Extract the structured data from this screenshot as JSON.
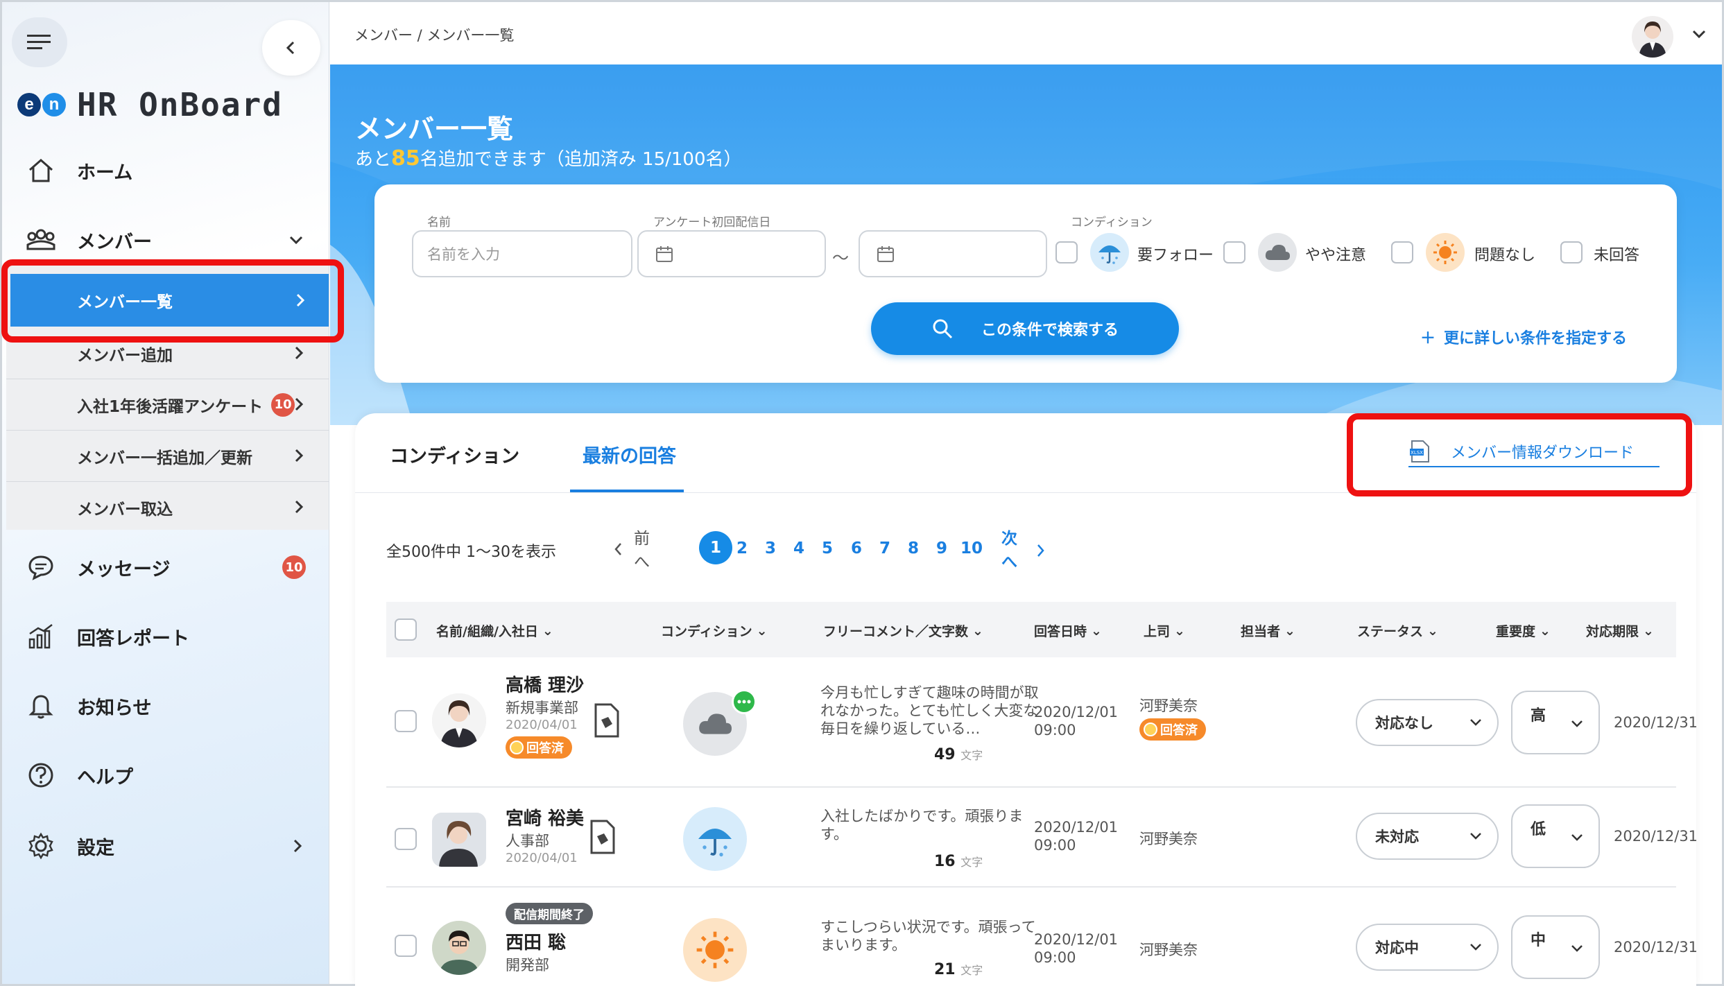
{
  "app": {
    "logo_text": "HR OnBoard",
    "logo_mark": [
      "e",
      "n"
    ]
  },
  "sidebar": {
    "home": "ホーム",
    "members": "メンバー",
    "sub": {
      "active": "メンバー一覧",
      "items": [
        "メンバー追加",
        "入社1年後活躍アンケート",
        "メンバー一括追加／更新",
        "メンバー取込"
      ],
      "survey_badge": "10"
    },
    "messages": "メッセージ",
    "messages_badge": "10",
    "report": "回答レポート",
    "notices": "お知らせ",
    "help": "ヘルプ",
    "settings": "設定"
  },
  "header": {
    "breadcrumb": "メンバー / メンバー一覧"
  },
  "page": {
    "title": "メンバー一覧",
    "sub_prefix": "あと",
    "sub_num": "85",
    "sub_suffix": "名追加できます（追加済み 15/100名）"
  },
  "search": {
    "name_label": "名前",
    "name_placeholder": "名前を入力",
    "date_label": "アンケート初回配信日",
    "date_sep": "〜",
    "condition_label": "コンディション",
    "conditions": [
      "要フォロー",
      "やや注意",
      "問題なし",
      "未回答"
    ],
    "button": "この条件で検索する",
    "advanced": "更に詳しい条件を指定する"
  },
  "tabs": [
    "コンディション",
    "最新の回答"
  ],
  "download": "メンバー情報ダウンロード",
  "pagination": {
    "summary": "全500件中 1〜30を表示",
    "prev": "前へ",
    "next": "次へ",
    "pages": [
      "1",
      "2",
      "3",
      "4",
      "5",
      "6",
      "7",
      "8",
      "9",
      "10"
    ],
    "current": "1"
  },
  "table": {
    "columns": [
      "名前/組織/入社日",
      "コンディション",
      "フリーコメント／文字数",
      "回答日時",
      "上司",
      "担当者",
      "ステータス",
      "重要度",
      "対応期限"
    ],
    "rows": [
      {
        "name": "高橋 理沙",
        "dept": "新規事業部",
        "joined": "2020/04/01",
        "answered": "回答済",
        "condition": "cloud",
        "comment": [
          "今月も忙しすぎて趣味の時間が取",
          "れなかった。とても忙しく大変な",
          "毎日を繰り返している…"
        ],
        "chars": "49",
        "chars_unit": "文字",
        "date": "2020/12/01",
        "time": "09:00",
        "boss": "河野美奈",
        "boss_answered": "回答済",
        "status": "対応なし",
        "priority": "高",
        "deadline": "2020/12/31"
      },
      {
        "name": "宮崎 裕美",
        "dept": "人事部",
        "joined": "2020/04/01",
        "condition": "umbrella",
        "comment": [
          "入社したばかりです。頑張りま",
          "す。"
        ],
        "chars": "16",
        "chars_unit": "文字",
        "date": "2020/12/01",
        "time": "09:00",
        "boss": "河野美奈",
        "status": "未対応",
        "priority": "低",
        "deadline": "2020/12/31"
      },
      {
        "name": "西田 聡",
        "dept": "開発部",
        "tag": "配信期間終了",
        "condition": "sun",
        "comment": [
          "すこしつらい状況です。頑張って",
          "まいります。"
        ],
        "chars": "21",
        "chars_unit": "文字",
        "date": "2020/12/01",
        "time": "09:00",
        "boss": "河野美奈",
        "status": "対応中",
        "priority": "中",
        "deadline": "2020/12/31"
      }
    ]
  },
  "colors": {
    "primary": "#168be6",
    "highlight": "#ee1111",
    "answered": "#f68a2a",
    "badge": "#e05545",
    "accent_number": "#ffc832"
  }
}
